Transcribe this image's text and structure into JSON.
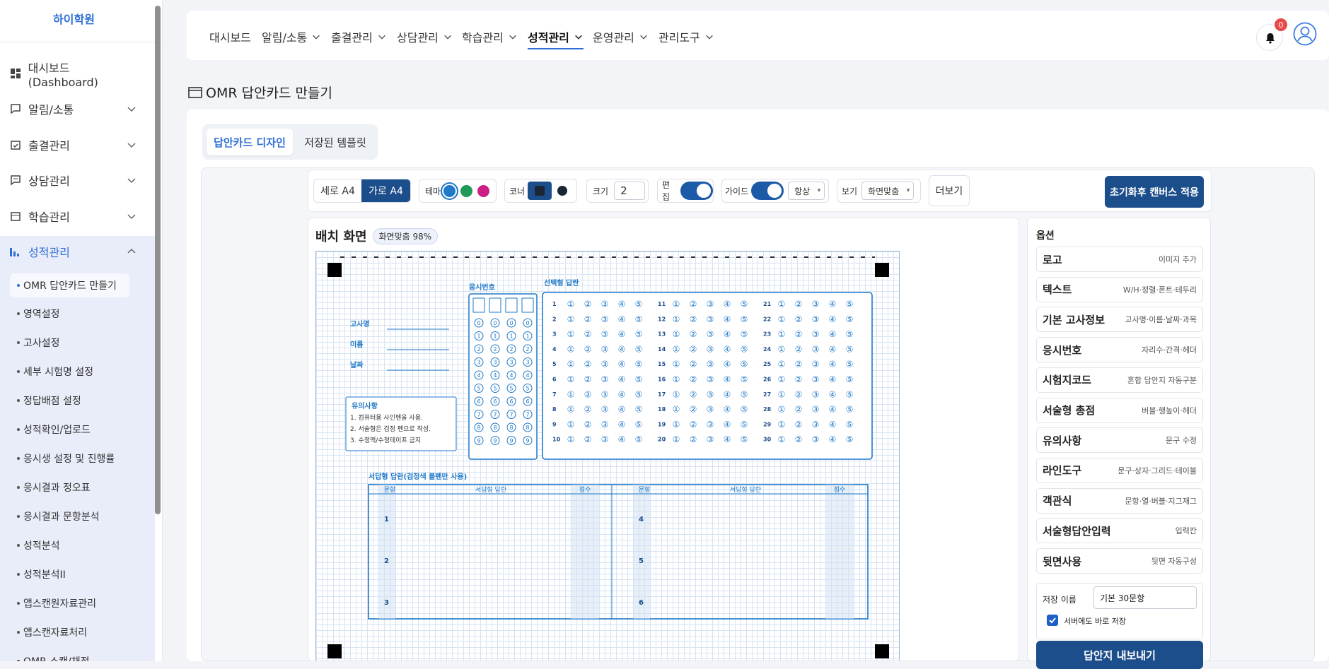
{
  "sidebar": {
    "brand": "하이학원",
    "items": [
      {
        "label": "대시보드(Dashboard)",
        "icon": "dashboard-icon"
      },
      {
        "label": "알림/소통",
        "icon": "chat-icon"
      },
      {
        "label": "출결관리",
        "icon": "calendar-check-icon"
      },
      {
        "label": "상담관리",
        "icon": "message-icon"
      },
      {
        "label": "학습관리",
        "icon": "calendar-icon"
      },
      {
        "label": "성적관리",
        "icon": "bar-chart-icon"
      }
    ],
    "sub": [
      "OMR 답안카드 만들기",
      "영역설정",
      "고사설정",
      "세부 시험명 설정",
      "정답배점 설정",
      "성적확인/업로드",
      "응시생 설정 및 진행률",
      "응시결과 정오표",
      "응시결과 문항분석",
      "성적분석",
      "성적분석II",
      "앱스캔원자료관리",
      "앱스캔자료처리",
      "OMR 스캔/채점"
    ]
  },
  "topnav": {
    "items": [
      "대시보드",
      "알림/소통",
      "출결관리",
      "상담관리",
      "학습관리",
      "성적관리",
      "운영관리",
      "관리도구"
    ],
    "badge": "0"
  },
  "page": {
    "title": "OMR 답안카드 만들기",
    "tab_design": "답안카드 디자인",
    "tab_saved": "저장된 템플릿"
  },
  "toolbar": {
    "portrait": "세로 A4",
    "landscape": "가로 A4",
    "theme": "테마",
    "theme_colors": [
      "#1f78c8",
      "#1f9a58",
      "#cc1f86"
    ],
    "corner": "코너",
    "size": "크기",
    "size_value": "2",
    "edit": "편집",
    "guide": "가이드",
    "guide_mode": "항상",
    "view": "보기",
    "view_mode": "화면맞춤",
    "more": "더보기",
    "apply": "초기화후 캔버스 적용"
  },
  "canvas": {
    "heading": "배치 화면",
    "fit": "화면맞춤 98%"
  },
  "sheet": {
    "exam_no": "응시번호",
    "choice": "선택형 답란",
    "info": [
      "고사명",
      "이름",
      "날짜"
    ],
    "notice_title": "유의사항",
    "notices": [
      "1. 컴퓨터용 사인펜을 사용.",
      "2. 서술형은 검정 펜으로 작성.",
      "3. 수정액/수정테이프 금지"
    ],
    "essay_title": "서답형 답란(검정색 볼펜만 사용)",
    "essay_headers": [
      "문항",
      "서답형 답란",
      "점수"
    ],
    "essay_left": [
      "1",
      "2",
      "3"
    ],
    "essay_right": [
      "4",
      "5",
      "6"
    ],
    "choice_circles": [
      "①",
      "②",
      "③",
      "④",
      "⑤"
    ],
    "digits": [
      "0",
      "1",
      "2",
      "3",
      "4",
      "5",
      "6",
      "7",
      "8",
      "9"
    ]
  },
  "options": {
    "title": "옵션",
    "items": [
      {
        "t": "로고",
        "d": "이미지 추가"
      },
      {
        "t": "텍스트",
        "d": "W/H·정렬·폰트·테두리"
      },
      {
        "t": "기본 고사정보",
        "d": "고사명·이름·날짜·과목"
      },
      {
        "t": "응시번호",
        "d": "자리수·간격·헤더"
      },
      {
        "t": "시험지코드",
        "d": "혼합 답안지 자동구분"
      },
      {
        "t": "서술형 총점",
        "d": "버블·행높이·헤더"
      },
      {
        "t": "유의사항",
        "d": "문구 수정"
      },
      {
        "t": "라인도구",
        "d": "문구·상자·그리드·테이블"
      },
      {
        "t": "객관식",
        "d": "문항·열·버블·지그재그"
      },
      {
        "t": "서술형답안입력",
        "d": "입력칸"
      },
      {
        "t": "뒷면사용",
        "d": "뒷면 자동구성"
      }
    ],
    "save_label": "저장 이름",
    "save_value": "기본 30문항",
    "server_save": "서버에도 바로 저장",
    "export": "답안지 내보내기"
  }
}
